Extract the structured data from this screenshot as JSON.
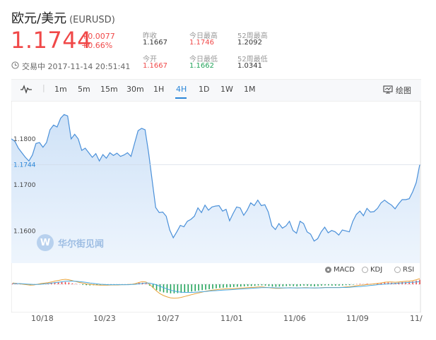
{
  "header": {
    "pair_name": "欧元/美元",
    "pair_code": "(EURUSD)",
    "price": "1.1744",
    "change_abs": "+0.0077",
    "change_pct": "+0.66%",
    "status_text": "交易中 2017-11-14 20:51:41"
  },
  "stats": {
    "prev_close_label": "昨收",
    "prev_close": "1.1667",
    "open_label": "今开",
    "open": "1.1667",
    "day_high_label": "今日最高",
    "day_high": "1.1746",
    "day_low_label": "今日最低",
    "day_low": "1.1662",
    "wk52_high_label": "52周最高",
    "wk52_high": "1.2092",
    "wk52_low_label": "52周最低",
    "wk52_low": "1.0341"
  },
  "toolbar": {
    "periods": [
      "1m",
      "5m",
      "15m",
      "30m",
      "1H",
      "4H",
      "1D",
      "1W",
      "1M"
    ],
    "active_period": "4H",
    "draw_label": "绘图"
  },
  "indicators": {
    "macd": "MACD",
    "kdj": "KDJ",
    "rsi": "RSI",
    "selected": "MACD"
  },
  "watermark": "华尔街见闻",
  "colors": {
    "up": "#f04848",
    "down": "#22a35a",
    "line": "#4a90d9",
    "accent": "#2a86d8"
  },
  "chart_data": {
    "type": "area",
    "y_ticks": [
      "1.1800",
      "1.1700",
      "1.1600"
    ],
    "current_label": "1.1744",
    "ylim": [
      1.153,
      1.1875
    ],
    "x_ticks": [
      "10/18",
      "10/23",
      "10/27",
      "11/01",
      "11/06",
      "11/09",
      "11/"
    ],
    "series": [
      {
        "values": [
          1.18,
          1.1795,
          1.178,
          1.177,
          1.176,
          1.1752,
          1.1765,
          1.179,
          1.1792,
          1.1782,
          1.1792,
          1.182,
          1.183,
          1.1826,
          1.1845,
          1.1853,
          1.185,
          1.18,
          1.181,
          1.18,
          1.1775,
          1.178,
          1.177,
          1.176,
          1.1768,
          1.1752,
          1.1766,
          1.1758,
          1.177,
          1.1764,
          1.1769,
          1.1762,
          1.1765,
          1.177,
          1.1762,
          1.179,
          1.1818,
          1.1823,
          1.182,
          1.177,
          1.171,
          1.1651,
          1.164,
          1.1641,
          1.1632,
          1.1602,
          1.1585,
          1.1598,
          1.1612,
          1.1609,
          1.1621,
          1.1625,
          1.1632,
          1.165,
          1.164,
          1.1656,
          1.1645,
          1.1652,
          1.1654,
          1.1655,
          1.1643,
          1.1647,
          1.1622,
          1.1638,
          1.1652,
          1.165,
          1.1634,
          1.1645,
          1.1661,
          1.1655,
          1.1667,
          1.1655,
          1.1657,
          1.1641,
          1.1611,
          1.1603,
          1.1616,
          1.1606,
          1.1611,
          1.1621,
          1.1601,
          1.1595,
          1.1621,
          1.1616,
          1.1598,
          1.1593,
          1.1578,
          1.1583,
          1.1598,
          1.1608,
          1.1596,
          1.1601,
          1.1598,
          1.1591,
          1.1602,
          1.16,
          1.1598,
          1.1621,
          1.1636,
          1.1643,
          1.1633,
          1.1649,
          1.1641,
          1.1642,
          1.1649,
          1.1661,
          1.1667,
          1.1661,
          1.1656,
          1.1648,
          1.1659,
          1.1668,
          1.1668,
          1.167,
          1.1685,
          1.1705,
          1.1744
        ]
      }
    ]
  },
  "macd_data": {
    "hist": [
      0.4,
      0.5,
      0.3,
      0.2,
      -0.2,
      -0.3,
      -0.2,
      0.1,
      0.3,
      0.2,
      0.4,
      0.7,
      0.9,
      1.0,
      1.2,
      1.0,
      0.8,
      0.4,
      0.2,
      0.0,
      -0.3,
      -0.4,
      -0.5,
      -0.4,
      -0.4,
      -0.4,
      -0.3,
      -0.3,
      -0.2,
      -0.3,
      -0.2,
      -0.2,
      -0.1,
      0.0,
      0.0,
      0.3,
      0.6,
      0.7,
      0.4,
      -0.6,
      -1.6,
      -2.6,
      -3.2,
      -3.6,
      -3.8,
      -4.0,
      -4.0,
      -3.9,
      -3.8,
      -3.6,
      -3.4,
      -3.2,
      -3.0,
      -2.8,
      -2.6,
      -2.4,
      -2.2,
      -2.0,
      -1.8,
      -1.6,
      -1.5,
      -1.4,
      -1.3,
      -1.2,
      -1.1,
      -1.0,
      -0.9,
      -0.8,
      -0.8,
      -0.7,
      -0.5,
      -0.5,
      -0.6,
      -0.8,
      -1.0,
      -1.1,
      -1.0,
      -0.9,
      -0.8,
      -0.7,
      -0.8,
      -0.9,
      -0.7,
      -0.6,
      -0.7,
      -0.8,
      -0.9,
      -0.8,
      -0.6,
      -0.5,
      -0.5,
      -0.6,
      -0.6,
      -0.6,
      -0.5,
      -0.4,
      -0.4,
      -0.2,
      0.1,
      0.2,
      0.1,
      0.3,
      0.2,
      0.3,
      0.4,
      0.6,
      0.8,
      0.8,
      0.7,
      0.6,
      0.8,
      1.0,
      1.0,
      1.1,
      1.3,
      1.6,
      2.0
    ],
    "dif": [
      0.6,
      0.4,
      0.2,
      0.0,
      -0.2,
      -0.4,
      -0.3,
      0.0,
      0.3,
      0.5,
      0.7,
      1.0,
      1.4,
      1.7,
      2.0,
      2.2,
      2.0,
      1.6,
      1.2,
      0.8,
      0.5,
      0.2,
      0.0,
      -0.2,
      -0.3,
      -0.4,
      -0.4,
      -0.4,
      -0.3,
      -0.3,
      -0.3,
      -0.2,
      -0.2,
      -0.1,
      0.0,
      0.3,
      0.8,
      1.2,
      1.0,
      0.0,
      -1.5,
      -3.0,
      -4.2,
      -5.0,
      -5.6,
      -6.0,
      -6.2,
      -6.1,
      -5.8,
      -5.4,
      -5.0,
      -4.6,
      -4.2,
      -3.8,
      -3.5,
      -3.1,
      -2.8,
      -2.6,
      -2.4,
      -2.2,
      -2.1,
      -2.0,
      -2.0,
      -1.9,
      -1.8,
      -1.7,
      -1.6,
      -1.5,
      -1.4,
      -1.3,
      -1.2,
      -1.2,
      -1.3,
      -1.5,
      -1.7,
      -1.8,
      -1.8,
      -1.7,
      -1.6,
      -1.5,
      -1.6,
      -1.7,
      -1.6,
      -1.5,
      -1.5,
      -1.6,
      -1.7,
      -1.6,
      -1.5,
      -1.4,
      -1.4,
      -1.4,
      -1.4,
      -1.4,
      -1.3,
      -1.2,
      -1.1,
      -0.9,
      -0.6,
      -0.4,
      -0.3,
      -0.1,
      0.0,
      0.2,
      0.4,
      0.6,
      0.9,
      1.0,
      1.0,
      0.9,
      1.0,
      1.2,
      1.3,
      1.4,
      1.6,
      2.0,
      2.5
    ],
    "dea": [
      0.3,
      0.3,
      0.3,
      0.2,
      0.1,
      0.0,
      -0.1,
      -0.1,
      0.0,
      0.2,
      0.3,
      0.5,
      0.7,
      0.9,
      1.1,
      1.3,
      1.4,
      1.4,
      1.3,
      1.2,
      1.0,
      0.8,
      0.6,
      0.4,
      0.2,
      0.0,
      -0.1,
      -0.2,
      -0.2,
      -0.2,
      -0.2,
      -0.2,
      -0.2,
      -0.2,
      -0.1,
      0.0,
      0.2,
      0.4,
      0.6,
      0.5,
      0.2,
      -0.3,
      -0.9,
      -1.5,
      -2.1,
      -2.6,
      -3.0,
      -3.3,
      -3.5,
      -3.6,
      -3.6,
      -3.6,
      -3.5,
      -3.4,
      -3.3,
      -3.2,
      -3.0,
      -2.9,
      -2.8,
      -2.7,
      -2.6,
      -2.5,
      -2.4,
      -2.3,
      -2.2,
      -2.1,
      -2.0,
      -1.9,
      -1.8,
      -1.7,
      -1.6,
      -1.5,
      -1.5,
      -1.5,
      -1.5,
      -1.6,
      -1.6,
      -1.6,
      -1.6,
      -1.6,
      -1.6,
      -1.6,
      -1.6,
      -1.6,
      -1.6,
      -1.6,
      -1.6,
      -1.6,
      -1.6,
      -1.5,
      -1.5,
      -1.5,
      -1.5,
      -1.5,
      -1.4,
      -1.4,
      -1.3,
      -1.2,
      -1.1,
      -1.0,
      -0.8,
      -0.7,
      -0.5,
      -0.4,
      -0.2,
      -0.1,
      0.1,
      0.2,
      0.3,
      0.4,
      0.5,
      0.6,
      0.7,
      0.8,
      0.9,
      1.0,
      1.2
    ]
  }
}
